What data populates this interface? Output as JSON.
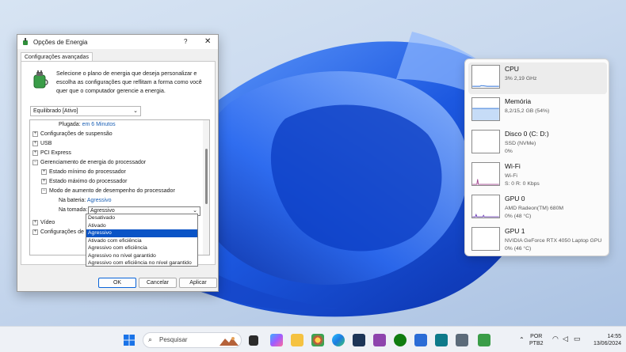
{
  "dialog": {
    "title": "Opções de Energia",
    "help": "?",
    "close": "✕",
    "tab": "Configurações avançadas",
    "intro": "Selecione o plano de energia que deseja personalizar e escolha as configurações que reflitam a forma como você quer que o computador gerencie a energia.",
    "plan": "Equilibrado [Ativo]",
    "tree": {
      "plugged_label": "Plugada:",
      "plugged_value": "em 6 Minutos",
      "suspend": "Configurações de suspensão",
      "usb": "USB",
      "pci": "PCI Express",
      "proc": "Gerenciamento de energia do processador",
      "min": "Estado mínimo do processador",
      "max": "Estado máximo do processador",
      "boost": "Modo de aumento de desempenho do processador",
      "battery_label": "Na bateria:",
      "battery_value": "Agressivo",
      "outlet_label": "Na tomada:",
      "outlet_value": "Agressivo",
      "video": "Vídeo",
      "config": "Configurações de t"
    },
    "options": [
      "Desativado",
      "Ativado",
      "Agressivo",
      "Ativado com eficiência",
      "Agressivo com eficiência",
      "Agressivo no nível garantido",
      "Agressivo com eficiência no nível garantido"
    ],
    "selected_option_index": 2,
    "buttons": {
      "ok": "OK",
      "cancel": "Cancelar",
      "apply": "Aplicar"
    }
  },
  "task_manager": {
    "items": [
      {
        "name": "CPU",
        "line1": "3%  2,19 GHz",
        "line2": "",
        "color": "#2a6fd6"
      },
      {
        "name": "Memória",
        "line1": "8,2/15,2 GB (54%)",
        "line2": "",
        "color": "#2a6fd6"
      },
      {
        "name": "Disco 0 (C: D:)",
        "line1": "SSD (NVMe)",
        "line2": "0%",
        "color": "#4d9a2a"
      },
      {
        "name": "Wi-Fi",
        "line1": "Wi-Fi",
        "line2": "S: 0  R: 0 Kbps",
        "color": "#a0468f"
      },
      {
        "name": "GPU 0",
        "line1": "AMD Radeon(TM) 680M",
        "line2": "0% (48 °C)",
        "color": "#6c3fb5"
      },
      {
        "name": "GPU 1",
        "line1": "NVIDIA GeForce RTX 4050 Laptop GPU",
        "line2": "0% (46 °C)",
        "color": "#6c3fb5"
      }
    ]
  },
  "taskbar": {
    "search": "Pesquisar",
    "lang1": "POR",
    "lang2": "PTB2",
    "time": "14:55",
    "date": "13/06/2024"
  },
  "colors": {
    "accent": "#0a54c6",
    "link": "#1a5fb4",
    "wallpaper": "#1e5fe0"
  }
}
